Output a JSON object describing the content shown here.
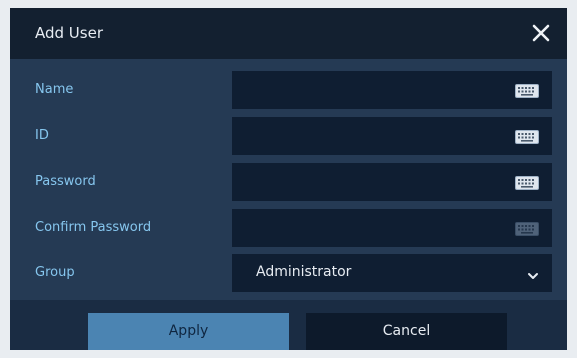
{
  "dialog": {
    "title": "Add User",
    "close_icon": "close-icon"
  },
  "form": {
    "fields": [
      {
        "label": "Name",
        "icon": "keyboard-icon"
      },
      {
        "label": "ID",
        "icon": "keyboard-icon"
      },
      {
        "label": "Password",
        "icon": "keyboard-icon"
      },
      {
        "label": "Confirm Password",
        "icon": "keyboard-icon"
      }
    ],
    "group": {
      "label": "Group",
      "selected": "Administrator",
      "icon": "chevron-down-icon"
    }
  },
  "footer": {
    "apply_label": "Apply",
    "cancel_label": "Cancel"
  },
  "colors": {
    "panel": "#253a54",
    "titlebar": "#132030",
    "field_bg": "#0f1e32",
    "label_text": "#86c6ee",
    "apply_bg": "#4b84b2",
    "cancel_bg": "#0d1a2b"
  }
}
